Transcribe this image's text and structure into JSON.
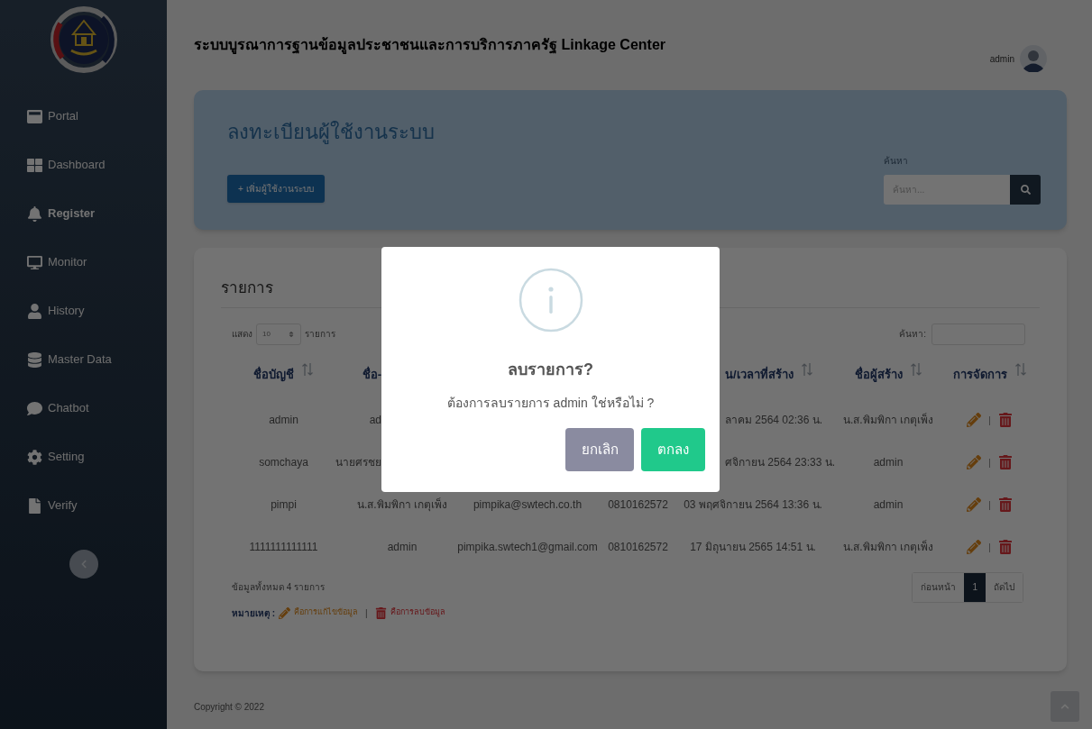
{
  "sidebar": {
    "items": [
      {
        "label": "Portal",
        "selected": false
      },
      {
        "label": "Dashboard",
        "selected": false
      },
      {
        "label": "Register",
        "selected": true
      },
      {
        "label": "Monitor",
        "selected": false
      },
      {
        "label": "History",
        "selected": false
      },
      {
        "label": "Master Data",
        "selected": false
      },
      {
        "label": "Chatbot",
        "selected": false
      },
      {
        "label": "Setting",
        "selected": false
      },
      {
        "label": "Verify",
        "selected": false
      }
    ]
  },
  "header": {
    "title": "ระบบบูรณาการฐานข้อมูลประชาชนและการบริการภาครัฐ Linkage Center",
    "user": "admin"
  },
  "register_panel": {
    "title": "ลงทะเบียนผู้ใช้งานระบบ",
    "add_button": "+ เพิ่มผู้ใช้งานระบบ",
    "search_label": "ค้นหา",
    "search_placeholder": "ค้นหา..."
  },
  "list_panel": {
    "title": "รายการ",
    "show_prefix": "แสดง",
    "page_size": "10",
    "show_suffix": "รายการ",
    "search_label": "ค้นหา:",
    "columns": [
      {
        "label": "ชื่อบัญชี",
        "sort": true
      },
      {
        "label": "ชื่อ-",
        "sort": false,
        "cut": true
      },
      null,
      null,
      {
        "label": "น/เวลาที่สร้าง",
        "sort": true,
        "cut": true
      },
      {
        "label": "ชื่อผู้สร้าง",
        "sort": true
      },
      {
        "label": "การจัดการ",
        "sort": true
      }
    ],
    "rows": [
      {
        "cells": [
          "admin",
          {
            "text": "ad",
            "cut": true
          },
          null,
          null,
          {
            "text": "ลาคม 2564 02:36 น.",
            "cut": true
          },
          "น.ส.พิมพิกา เกตุเพ็ง"
        ],
        "separator": "|"
      },
      {
        "cells": [
          "somchaya",
          {
            "text": "นายศรชย",
            "cut": true
          },
          null,
          null,
          {
            "text": "ศจิกายน 2564 23:33 น.",
            "cut": true
          },
          "admin"
        ],
        "separator": "|"
      },
      {
        "cells": [
          "pimpi",
          "น.ส.พิมพิกา เกตุเพ็ง",
          "pimpika@swtech.co.th",
          "0810162572",
          "03 พฤศจิกายน 2564 13:36 น.",
          "admin"
        ],
        "separator": "|"
      },
      {
        "cells": [
          "1111111111111",
          "admin",
          "pimpika.swtech1@gmail.com",
          "0810162572",
          "17 มิถุนายน 2565 14:51 น.",
          "น.ส.พิมพิกา เกตุเพ็ง"
        ],
        "separator": "|"
      }
    ],
    "total": "ข้อมูลทั้งหมด 4 รายการ",
    "pagination": [
      {
        "label": "ก่อนหน้า",
        "selected": false
      },
      {
        "label": "1",
        "selected": true
      },
      {
        "label": "ถัดไป",
        "selected": false
      }
    ],
    "note": {
      "label": "หมายเหตุ :",
      "edit": "คือการแก้ไขข้อมูล",
      "separator": "|",
      "delete": "คือการลบข้อมูล"
    }
  },
  "footer": {
    "copyright": "Copyright © 2022"
  },
  "dialog": {
    "title": "ลบรายการ?",
    "message": "ต้องการลบรายการ admin ใช่หรือไม่ ?",
    "buttons": [
      {
        "label": "ยกเลิก",
        "kind": "cancel"
      },
      {
        "label": "ตกลง",
        "kind": "confirm"
      }
    ]
  }
}
